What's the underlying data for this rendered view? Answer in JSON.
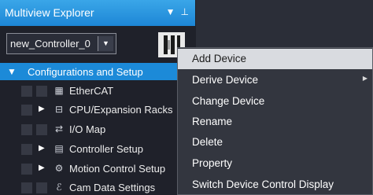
{
  "explorer": {
    "title": "Multiview Explorer",
    "header_buttons": {
      "dropdown": "▾",
      "pin": "ᵖ"
    },
    "controller_select": {
      "value": "new_Controller_0"
    },
    "tree": {
      "root_label": "Configurations and Setup",
      "items": [
        {
          "label": "EtherCAT",
          "icon": "ethercat-icon"
        },
        {
          "label": "CPU/Expansion Racks",
          "icon": "rack-icon"
        },
        {
          "label": "I/O Map",
          "icon": "io-map-icon"
        },
        {
          "label": "Controller Setup",
          "icon": "controller-setup-icon"
        },
        {
          "label": "Motion Control Setup",
          "icon": "motion-gear-icon"
        },
        {
          "label": "Cam Data Settings",
          "icon": "cam-icon"
        }
      ]
    }
  },
  "context_menu": {
    "items": [
      {
        "label": "Add Device"
      },
      {
        "label": "Derive Device"
      },
      {
        "label": "Change Device"
      },
      {
        "label": "Rename"
      },
      {
        "label": "Delete"
      },
      {
        "label": "Property"
      },
      {
        "label": "Switch Device Control Display"
      }
    ]
  }
}
